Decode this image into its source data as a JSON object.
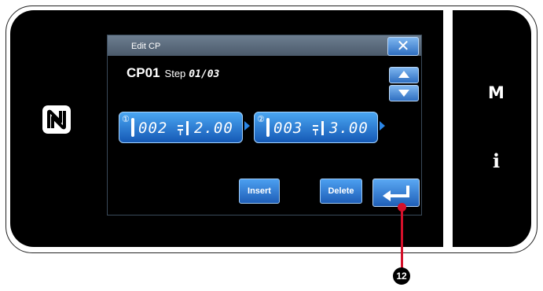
{
  "window": {
    "title": "Edit CP",
    "close_symbol": "✕"
  },
  "header": {
    "cp_name": "CP01",
    "step_label": "Step",
    "step_value": "01/03"
  },
  "steps": [
    {
      "index_symbol": "①",
      "stitch_count": "002",
      "pitch": "2.00"
    },
    {
      "index_symbol": "②",
      "stitch_count": "003",
      "pitch": "3.00"
    }
  ],
  "buttons": {
    "insert_label": "Insert",
    "delete_label": "Delete"
  },
  "side_panel": {
    "mode_label": "M",
    "info_label": "i"
  },
  "callout": {
    "number": "12"
  },
  "icons": {
    "nfc": "nfc-icon",
    "close": "close-icon",
    "scroll_up": "triangle-up-icon",
    "scroll_down": "triangle-down-icon",
    "needle": "needle-icon",
    "pitch": "stitch-pitch-icon",
    "next": "arrow-right-icon",
    "enter": "enter-arrow-icon"
  },
  "colors": {
    "accent": "#2b86e6",
    "screen_bg": "#000000",
    "callout": "#d4102a"
  }
}
